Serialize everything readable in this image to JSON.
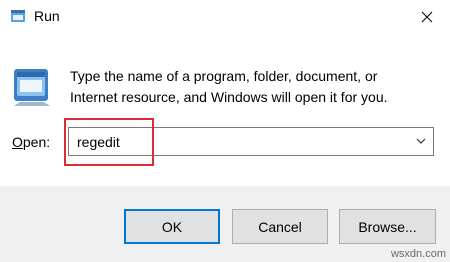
{
  "window": {
    "title": "Run",
    "close_glyph": "✕"
  },
  "icons": {
    "title": "run-icon",
    "large": "run-icon",
    "close": "close-icon",
    "dropdown": "chevron-down-icon"
  },
  "description": {
    "line1": "Type the name of a program, folder, document, or",
    "line2": "Internet resource, and Windows will open it for you."
  },
  "open_field": {
    "label_access_key": "O",
    "label_rest": "pen:",
    "value": "regedit"
  },
  "buttons": {
    "ok": "OK",
    "cancel": "Cancel",
    "browse": "Browse..."
  },
  "highlight_color": "#d92c34",
  "watermark": "wsxdn.com"
}
